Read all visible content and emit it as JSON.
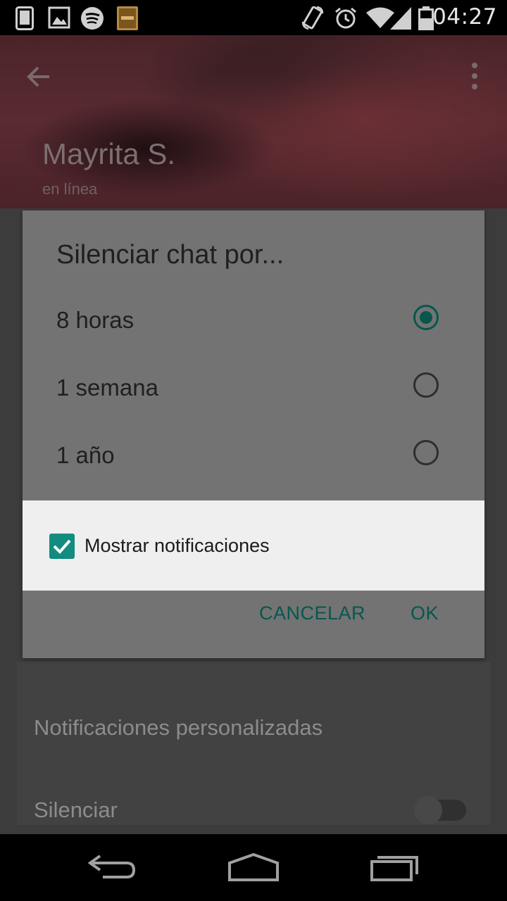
{
  "status_bar": {
    "time": "04:27",
    "left_icons": [
      "phone-icon",
      "gallery-icon",
      "spotify-icon",
      "bible-app-icon"
    ],
    "right_icons": [
      "rotate-icon",
      "alarm-icon",
      "wifi-icon",
      "signal-icon",
      "battery-icon"
    ]
  },
  "header": {
    "contact_name": "Mayrita S.",
    "contact_status": "en línea"
  },
  "background_settings": {
    "custom_notifications_label": "Notificaciones personalizadas",
    "mute_label": "Silenciar",
    "mute_enabled": false
  },
  "dialog": {
    "title": "Silenciar chat por...",
    "options": [
      {
        "label": "8 horas",
        "selected": true
      },
      {
        "label": "1 semana",
        "selected": false
      },
      {
        "label": "1 año",
        "selected": false
      }
    ],
    "show_notifications_label": "Mostrar notificaciones",
    "show_notifications_checked": true,
    "cancel_label": "CANCELAR",
    "ok_label": "OK"
  },
  "colors": {
    "accent": "#07574e",
    "checkbox": "#128c7e",
    "dialog_background": "#737373"
  }
}
